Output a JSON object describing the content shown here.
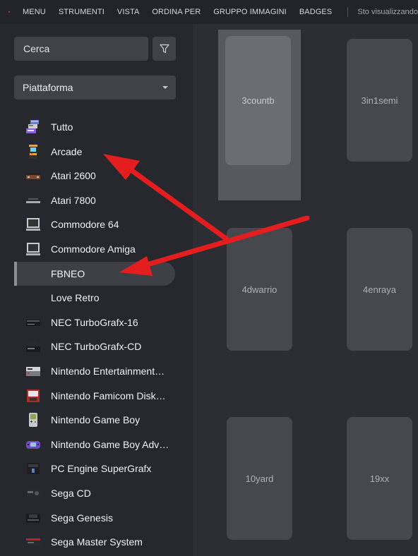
{
  "menu": {
    "items": [
      "MENU",
      "STRUMENTI",
      "VISTA",
      "ORDINA PER",
      "GRUPPO IMMAGINI",
      "BADGES"
    ],
    "status": "Sto visualizzando"
  },
  "sidebar": {
    "search": {
      "placeholder": "Cerca"
    },
    "platform_select": {
      "value": "Piattaforma"
    },
    "platforms": [
      {
        "label": "Tutto",
        "icon": "stacked-consoles-icon"
      },
      {
        "label": "Arcade",
        "icon": "arcade-cabinet-icon"
      },
      {
        "label": "Atari 2600",
        "icon": "atari-2600-icon"
      },
      {
        "label": "Atari 7800",
        "icon": "atari-7800-icon"
      },
      {
        "label": "Commodore 64",
        "icon": "computer-monitor-icon"
      },
      {
        "label": "Commodore Amiga",
        "icon": "computer-monitor-icon"
      },
      {
        "label": "FBNEO",
        "icon": "",
        "selected": true
      },
      {
        "label": "Love Retro",
        "icon": ""
      },
      {
        "label": "NEC TurboGrafx-16",
        "icon": "turbografx-console-icon"
      },
      {
        "label": "NEC TurboGrafx-CD",
        "icon": "turbografx-cd-icon"
      },
      {
        "label": "Nintendo Entertainment…",
        "icon": "nes-console-icon"
      },
      {
        "label": "Nintendo Famicom Disk…",
        "icon": "famicom-disk-icon"
      },
      {
        "label": "Nintendo Game Boy",
        "icon": "game-boy-icon"
      },
      {
        "label": "Nintendo Game Boy Adv…",
        "icon": "game-boy-advance-icon"
      },
      {
        "label": "PC Engine SuperGrafx",
        "icon": "supergrafx-icon"
      },
      {
        "label": "Sega CD",
        "icon": "sega-cd-icon"
      },
      {
        "label": "Sega Genesis",
        "icon": "sega-genesis-icon"
      },
      {
        "label": "Sega Master System",
        "icon": "sega-master-system-icon"
      }
    ]
  },
  "games": [
    {
      "title": "3countb",
      "selected": true
    },
    {
      "title": "3in1semi"
    },
    {
      "title": "4dwarrio"
    },
    {
      "title": "4enraya"
    },
    {
      "title": "10yard"
    },
    {
      "title": "19xx"
    }
  ],
  "colors": {
    "annotation_arrow": "#e41e1e",
    "sidebar_bg": "#27282d",
    "grid_bg": "#2d2e34",
    "tile_bg": "#47484e",
    "tile_selected_bg": "#6c6d73"
  }
}
